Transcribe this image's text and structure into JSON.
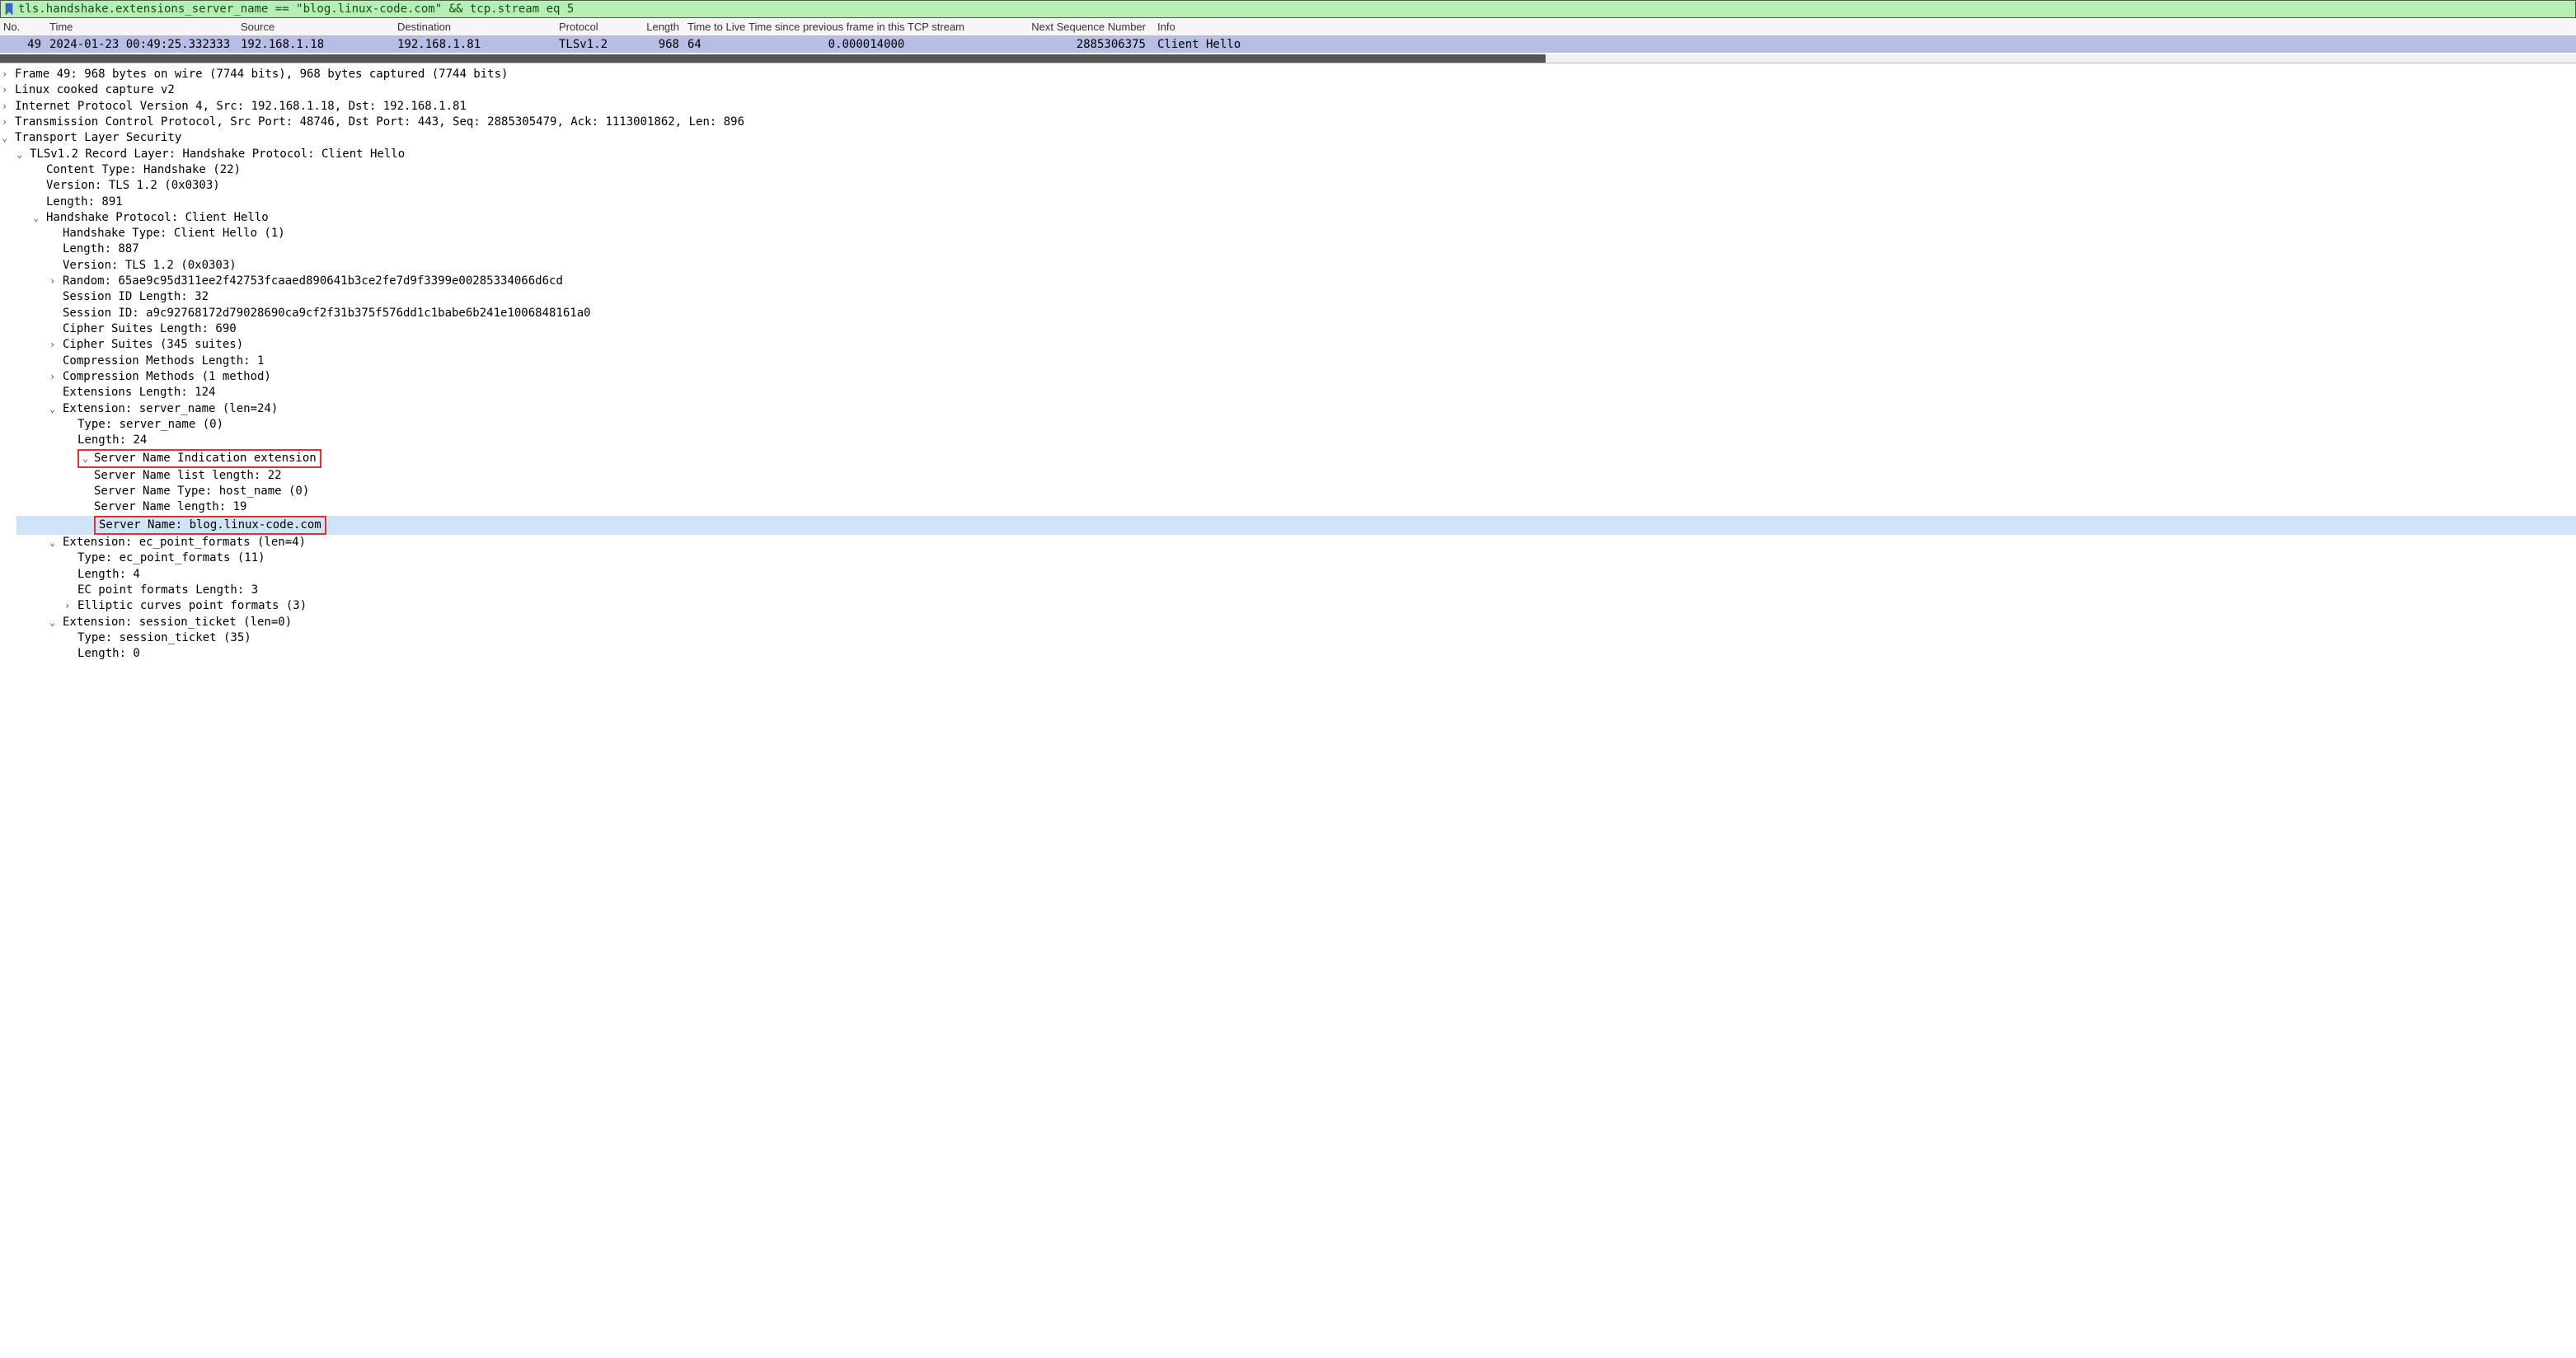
{
  "filter": {
    "value": "tls.handshake.extensions_server_name == \"blog.linux-code.com\" && tcp.stream eq 5"
  },
  "columns": {
    "no": "No.",
    "time": "Time",
    "source": "Source",
    "destination": "Destination",
    "protocol": "Protocol",
    "length": "Length",
    "ttl": "Time to Live",
    "delta": "Time since previous frame in this TCP stream",
    "seq": "Next Sequence Number",
    "info": "Info"
  },
  "row": {
    "no": "49",
    "time": "2024-01-23 00:49:25.332333",
    "source": "192.168.1.18",
    "destination": "192.168.1.81",
    "protocol": "TLSv1.2",
    "length": "968",
    "ttl": "64",
    "delta": "0.000014000",
    "seq": "2885306375",
    "info": "Client Hello"
  },
  "details": {
    "frame": "Frame 49: 968 bytes on wire (7744 bits), 968 bytes captured (7744 bits)",
    "cooked": "Linux cooked capture v2",
    "ip": "Internet Protocol Version 4, Src: 192.168.1.18, Dst: 192.168.1.81",
    "tcp": "Transmission Control Protocol, Src Port: 48746, Dst Port: 443, Seq: 2885305479, Ack: 1113001862, Len: 896",
    "tls": "Transport Layer Security",
    "record": "TLSv1.2 Record Layer: Handshake Protocol: Client Hello",
    "r_ctype": "Content Type: Handshake (22)",
    "r_ver": "Version: TLS 1.2 (0x0303)",
    "r_len": "Length: 891",
    "hs": "Handshake Protocol: Client Hello",
    "hs_type": "Handshake Type: Client Hello (1)",
    "hs_len": "Length: 887",
    "hs_ver": "Version: TLS 1.2 (0x0303)",
    "random": "Random: 65ae9c95d311ee2f42753fcaaed890641b3ce2fe7d9f3399e00285334066d6cd",
    "sidlen": "Session ID Length: 32",
    "sid": "Session ID: a9c92768172d79028690ca9cf2f31b375f576dd1c1babe6b241e1006848161a0",
    "cslen": "Cipher Suites Length: 690",
    "cs": "Cipher Suites (345 suites)",
    "cmlen": "Compression Methods Length: 1",
    "cm": "Compression Methods (1 method)",
    "extlen": "Extensions Length: 124",
    "ext_sni": "Extension: server_name (len=24)",
    "sni_type": "Type: server_name (0)",
    "sni_len": "Length: 24",
    "sni_indic": "Server Name Indication extension",
    "sni_listlen": "Server Name list length: 22",
    "sni_nametype": "Server Name Type: host_name (0)",
    "sni_namelen": "Server Name length: 19",
    "sni_name": "Server Name: blog.linux-code.com",
    "ext_ec": "Extension: ec_point_formats (len=4)",
    "ec_type": "Type: ec_point_formats (11)",
    "ec_len": "Length: 4",
    "ec_fmtlen": "EC point formats Length: 3",
    "ec_curves": "Elliptic curves point formats (3)",
    "ext_ticket": "Extension: session_ticket (len=0)",
    "ticket_type": "Type: session_ticket (35)",
    "ticket_len": "Length: 0"
  }
}
